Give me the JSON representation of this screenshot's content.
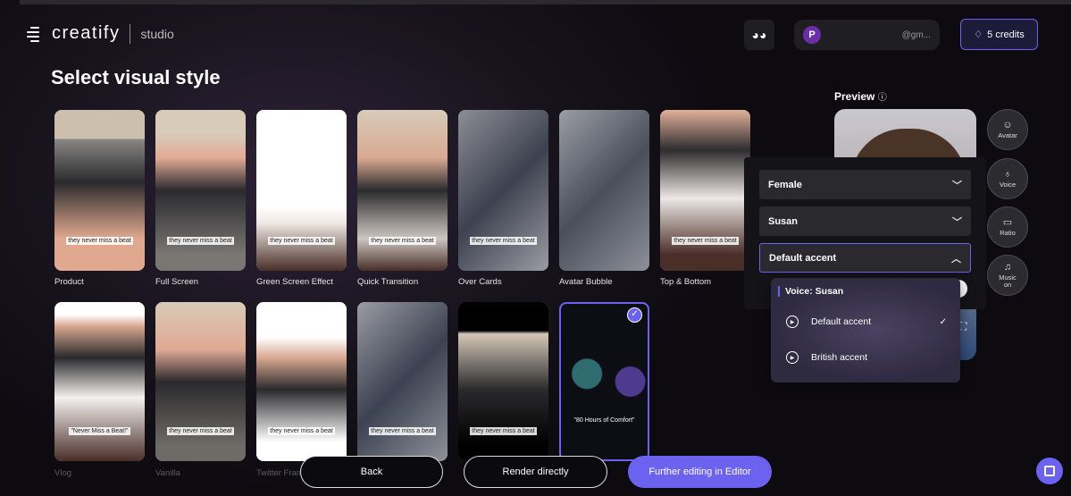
{
  "header": {
    "logo": "creatify",
    "product": "studio",
    "user_initial": "P",
    "email": "@gm...",
    "credits": "5 credits",
    "discord_icon": "discord-icon"
  },
  "page_title": "Select visual style",
  "styles": [
    {
      "label": "Product",
      "caption": "they never miss a beat",
      "bg": "linear-gradient(#cdbfae 0%,#cdbfae 18%,#8a8886 18%,#2a2a2c 45%,#e0a98f 80%)"
    },
    {
      "label": "Full Screen",
      "caption": "they never miss a beat",
      "bg": "linear-gradient(#d8cbb8 0%,#d8cbb8 15%,#e1a995 30%,#2a2a2c 50%,#7a7674 90%)"
    },
    {
      "label": "Green Screen Effect",
      "caption": "they never miss a beat",
      "bg": "linear-gradient(#fff 0%,#fff 60%,#efe9e4 70%,#4a2e28 100%)"
    },
    {
      "label": "Quick Transition",
      "caption": "they never miss a beat",
      "bg": "linear-gradient(#d8cbb8 0%,#d9a892 30%,#2b2b2d 50%,#ccc6c1 80%,#4a2e28 100%)"
    },
    {
      "label": "Over Cards",
      "caption": "they never miss a beat",
      "bg": "linear-gradient(135deg,#8b8e95,#3e4250 50%,#9a9ca3)"
    },
    {
      "label": "Avatar Bubble",
      "caption": "",
      "bg": "linear-gradient(135deg,#9a9da4,#4a4f5c 50%,#8d9098)"
    },
    {
      "label": "Top & Bottom",
      "caption": "they never miss a beat",
      "bg": "linear-gradient(#e3b09b 0%,#2d2c2e 25%,#ece7e4 55%,#4a2e28 90%)"
    },
    {
      "label": "Vlog",
      "caption": "\"Never Miss a Beat!\"",
      "bg": "linear-gradient(#fff 0%,#fff 8%,#d9a892 15%,#2a2a2c 35%,#f3f1ef 60%,#4a2e28 100%)"
    },
    {
      "label": "Vanilla",
      "caption": "they never miss a beat",
      "bg": "linear-gradient(#d8cbb8 0%,#e0a995 30%,#2a2a2c 50%,#6e6a66 90%)"
    },
    {
      "label": "Twitter Fram",
      "caption": "they never miss a beat",
      "bg": "linear-gradient(#fff 0%,#fff 22%,#d9a892 35%,#2a2a2c 55%,#fff 88%)"
    },
    {
      "label": "S",
      "caption": "they never miss a beat",
      "bg": "linear-gradient(135deg,#9a9ca3,#3c4252 50%,#8e9198)"
    },
    {
      "label": "",
      "caption": "they never miss a beat",
      "bg": "linear-gradient(#000 0%,#000 18%,#d5c7b8 20%,#2a2a2c 55%,#000 90%)"
    },
    {
      "label": "",
      "caption": "\"80 Hours of Comfort\"",
      "bg": "radial-gradient(circle at 30% 45%,#2e6c6f 0,#2e6c6f 14%,transparent 15%),radial-gradient(circle at 80% 50%,#4e3a8e 0,#4e3a8e 14%,transparent 15%),#0d0d14"
    }
  ],
  "preview": {
    "title": "Preview",
    "info_icon": "info-icon"
  },
  "side_buttons": [
    {
      "label": "Avatar",
      "icon": "person-icon"
    },
    {
      "label": "Voice",
      "icon": "voice-icon"
    },
    {
      "label": "Ratio",
      "icon": "ratio-icon"
    },
    {
      "label": "Music on",
      "icon": "music-icon"
    }
  ],
  "voice_panel": {
    "gender": "Female",
    "voice": "Susan",
    "accent": "Default accent"
  },
  "accent_menu": {
    "heading": "Voice: Susan",
    "options": [
      {
        "label": "Default accent",
        "selected": true
      },
      {
        "label": "British accent",
        "selected": false
      }
    ]
  },
  "footer": {
    "back": "Back",
    "render": "Render directly",
    "editor": "Further editing in Editor"
  },
  "colors": {
    "accent": "#6b62f0"
  }
}
